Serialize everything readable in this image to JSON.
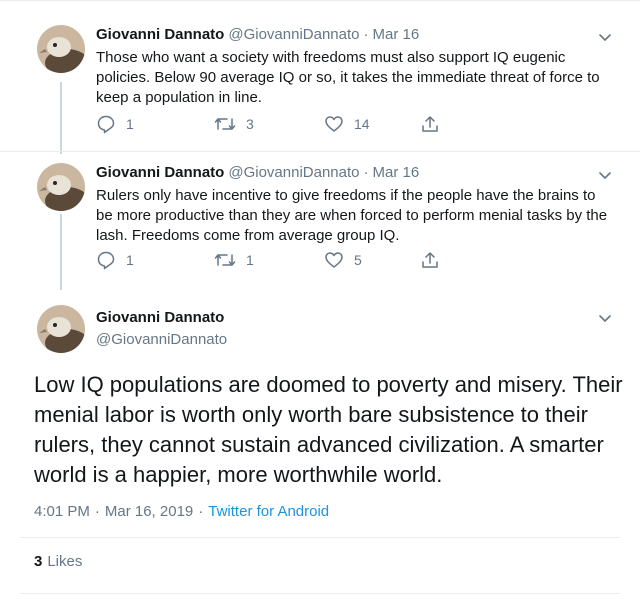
{
  "colors": {
    "link": "#1b95e0",
    "secondary": "#657786",
    "text": "#14171a",
    "border": "#e6ecf0"
  },
  "replies": [
    {
      "name": "Giovanni Dannato",
      "handle": "@GiovanniDannato",
      "separator": "·",
      "date": "Mar 16",
      "text": "Those who want a society with freedoms must also support IQ eugenic policies. Below 90 average IQ or so, it takes the immediate threat of force to keep a population in line.",
      "reply_count": "1",
      "retweet_count": "3",
      "like_count": "14"
    },
    {
      "name": "Giovanni Dannato",
      "handle": "@GiovanniDannato",
      "separator": "·",
      "date": "Mar 16",
      "text": "Rulers only have incentive to give freedoms if the people have the brains to be more productive than they are when forced to perform menial tasks by the lash. Freedoms come from average group IQ.",
      "reply_count": "1",
      "retweet_count": "1",
      "like_count": "5"
    }
  ],
  "main_tweet": {
    "name": "Giovanni Dannato",
    "handle": "@GiovanniDannato",
    "text": "Low IQ populations are doomed to poverty and misery. Their menial labor is worth only worth bare subsistence to their rulers, they cannot sustain advanced civilization. A smarter world is a happier, more worthwhile world.",
    "time": "4:01 PM",
    "separator": "·",
    "date": "Mar 16, 2019",
    "separator2": "·",
    "source": "Twitter for Android",
    "likes_count": "3",
    "likes_label": "Likes"
  },
  "icons": [
    "avatar-image",
    "chevron-down-icon",
    "reply-icon",
    "retweet-icon",
    "like-icon",
    "share-icon"
  ]
}
